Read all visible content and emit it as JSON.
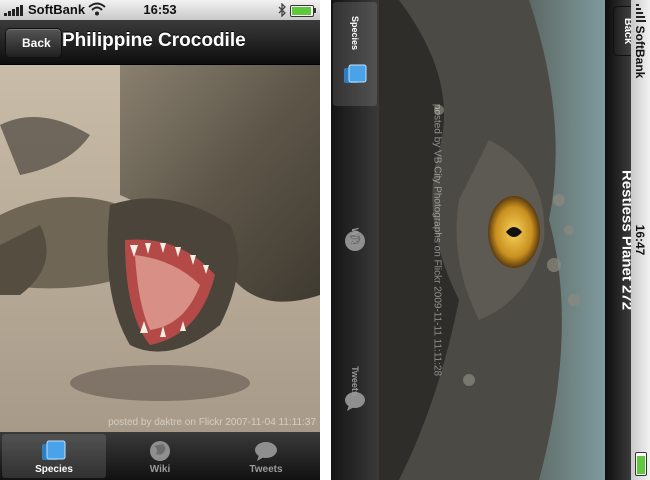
{
  "left_screen": {
    "status_bar": {
      "carrier": "SoftBank",
      "time": "16:53"
    },
    "nav": {
      "back_label": "Back",
      "title": "Philippine Crocodile"
    },
    "photo_credit": "posted by daktre on Flickr 2007-11-04 11:11:37",
    "tabs": [
      {
        "label": "Species",
        "icon": "species-icon",
        "active": true
      },
      {
        "label": "Wiki",
        "icon": "globe-icon",
        "active": false
      },
      {
        "label": "Tweets",
        "icon": "speech-bubble-icon",
        "active": false
      }
    ]
  },
  "right_screen": {
    "status_bar": {
      "carrier": "SoftBank",
      "time": "16:47"
    },
    "nav": {
      "back_label": "Back",
      "title": "Restless Planet 272"
    },
    "photo_credit": "posted by VB City Photographs on Flickr 2009-11-11 11:11:28",
    "tabs": [
      {
        "label": "Species",
        "icon": "species-icon",
        "active": true
      },
      {
        "label": "Wiki",
        "icon": "globe-icon",
        "active": false
      },
      {
        "label": "Tweets",
        "icon": "speech-bubble-icon",
        "active": false
      }
    ]
  },
  "colors": {
    "accent_blue": "#4aa3e8",
    "battery_green": "#5ec93a",
    "bar_dark": "#111111"
  }
}
